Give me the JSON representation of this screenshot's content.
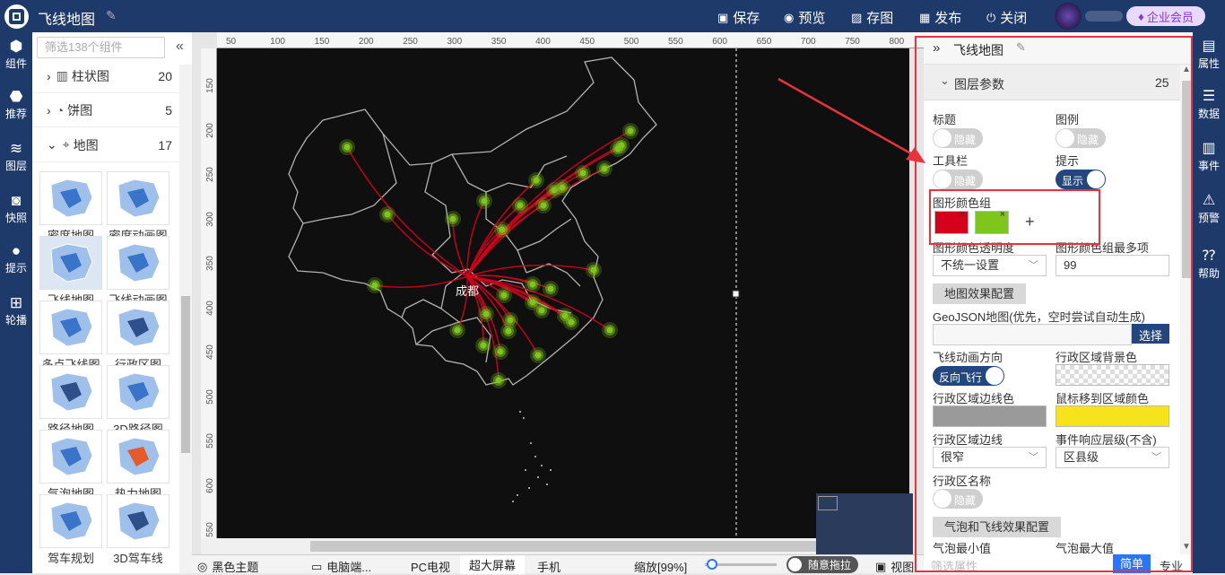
{
  "app": {
    "title": "飞线地图"
  },
  "toolbar": {
    "save": "保存",
    "preview": "预览",
    "snapshot": "存图",
    "publish": "发布",
    "close": "关闭",
    "vip": "企业会员"
  },
  "left_nav": [
    "组件",
    "推荐",
    "图层",
    "快照",
    "提示",
    "轮播"
  ],
  "right_nav": [
    "属性",
    "数据",
    "事件",
    "预警",
    "帮助"
  ],
  "component_panel": {
    "search_placeholder": "筛选138个组件",
    "categories": [
      {
        "label": "柱状图",
        "count": "20",
        "expanded": false
      },
      {
        "label": "饼图",
        "count": "5",
        "expanded": false
      },
      {
        "label": "地图",
        "count": "17",
        "expanded": true
      }
    ],
    "tiles": [
      "密度地图",
      "密度动画图",
      "飞线地图",
      "飞线动画图",
      "多点飞线图",
      "行政区图",
      "路径地图",
      "3D路径图",
      "气泡地图",
      "热力地图",
      "驾车规划",
      "3D驾车线"
    ],
    "selected_tile": "飞线地图"
  },
  "ruler": {
    "h": [
      "50",
      "100",
      "150",
      "200",
      "250",
      "300",
      "350",
      "400",
      "450",
      "500",
      "550",
      "600",
      "650",
      "700",
      "750",
      "800"
    ],
    "v": [
      "150",
      "200",
      "250",
      "300",
      "350",
      "400",
      "450",
      "500",
      "550",
      "600",
      "550"
    ]
  },
  "map": {
    "origin_label": "成都"
  },
  "bottom": {
    "theme": "黑色主题",
    "pc_end": "电脑端...",
    "pc_tv": "PC电视",
    "big_screen": "超大屏幕",
    "mobile": "手机",
    "zoom": "缩放[99%]",
    "drag": "随意拖拉",
    "view": "视图"
  },
  "props": {
    "panel_title": "飞线地图",
    "section": "图层参数",
    "section_count": "25",
    "title_label": "标题",
    "title_toggle": "隐藏",
    "legend_label": "图例",
    "legend_toggle": "隐藏",
    "toolbar_label": "工具栏",
    "toolbar_toggle": "隐藏",
    "tip_label": "提示",
    "tip_toggle": "显示",
    "color_group_label": "图形颜色组",
    "colors": [
      "#d4001c",
      "#7ec51c"
    ],
    "opacity_label": "图形颜色透明度",
    "opacity_value": "不统一设置",
    "max_label": "图形颜色组最多项",
    "max_value": "99",
    "map_effect_btn": "地图效果配置",
    "geojson_label": "GeoJSON地图(优先，空时尝试自动生成)",
    "choose_btn": "选择",
    "fly_dir_label": "飞线动画方向",
    "fly_dir_toggle": "反向飞行",
    "region_bg_label": "行政区域背景色",
    "border_color_label": "行政区域边线色",
    "border_color": "#9a9a9a",
    "hover_color_label": "鼠标移到区域颜色",
    "hover_color": "#f7e31b",
    "border_width_label": "行政区域边线",
    "border_width_value": "很窄",
    "event_level_label": "事件响应层级(不含)",
    "event_level_value": "区县级",
    "region_name_label": "行政区名称",
    "region_name_toggle": "隐藏",
    "bubble_btn": "气泡和飞线效果配置",
    "bubble_min_label": "气泡最小值",
    "bubble_max_label": "气泡最大值",
    "filter_placeholder": "筛选属性",
    "simple": "简单",
    "pro": "专业"
  }
}
